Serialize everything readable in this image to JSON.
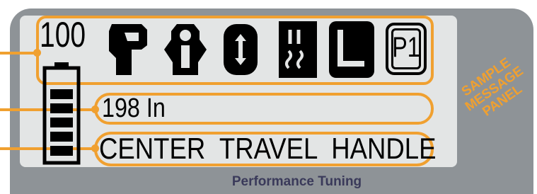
{
  "display": {
    "battery_percent": "100",
    "distance": "198 In",
    "message": "CENTER  TRAVEL  HANDLE"
  },
  "icons": [
    {
      "name": "wrench-icon"
    },
    {
      "name": "person-icon"
    },
    {
      "name": "stretch-icon"
    },
    {
      "name": "heat-icon"
    },
    {
      "name": "recline-icon"
    },
    {
      "name": "preset-p1-icon",
      "label": "P1"
    }
  ],
  "footer": "Performance Tuning",
  "callout": {
    "line1": "SAMPLE",
    "line2": "MESSAGE",
    "line3": "PANEL"
  },
  "colors": {
    "accent": "#f0a030",
    "bezel": "#8e9397",
    "screen": "#e3e5e5",
    "footer_text": "#3a3a5a"
  }
}
